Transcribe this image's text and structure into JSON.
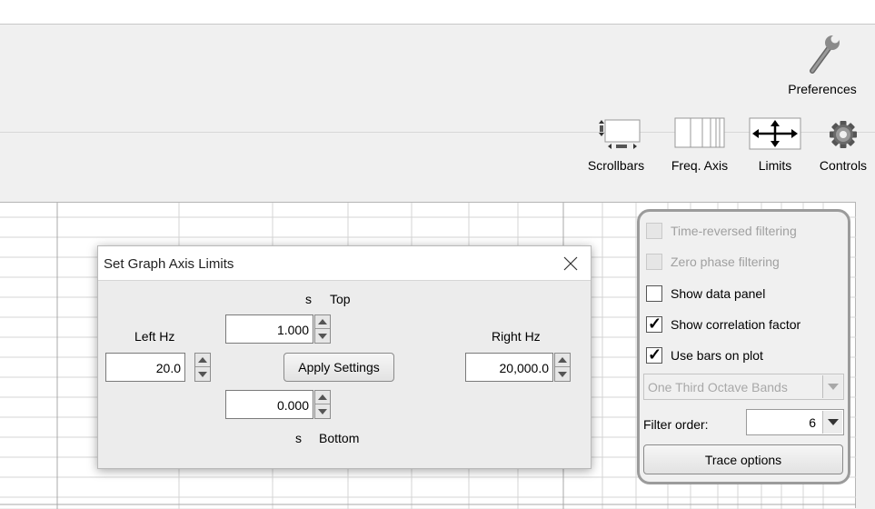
{
  "toolbar": {
    "preferences_label": "Preferences",
    "scrollbars_label": "Scrollbars",
    "freq_axis_label": "Freq. Axis",
    "limits_label": "Limits",
    "controls_label": "Controls",
    "icons": {
      "preferences": "wrench-icon",
      "scrollbars": "scrollbars-icon",
      "freq_axis": "freq-axis-icon",
      "limits": "move-arrows-icon",
      "controls": "gear-icon"
    }
  },
  "side_panel": {
    "time_reversed_label": "Time-reversed filtering",
    "time_reversed_checked": false,
    "zero_phase_label": "Zero phase filtering",
    "zero_phase_checked": false,
    "show_data_panel_label": "Show data panel",
    "show_data_panel_checked": false,
    "show_correlation_label": "Show correlation factor",
    "show_correlation_checked": true,
    "use_bars_label": "Use bars on plot",
    "use_bars_checked": true,
    "check_mark": "✓",
    "bands_value": "One Third Octave Bands",
    "filter_order_label": "Filter order:",
    "filter_order_value": "6",
    "trace_options_label": "Trace options"
  },
  "dialog": {
    "title": "Set Graph Axis Limits",
    "close_icon": "close-icon",
    "top_unit": "s",
    "top_label": "Top",
    "top_value": "1.000",
    "bottom_unit": "s",
    "bottom_label": "Bottom",
    "bottom_value": "0.000",
    "left_label": "Left Hz",
    "left_value": "20.0",
    "right_label": "Right Hz",
    "right_value": "20,000.0",
    "apply_label": "Apply Settings"
  }
}
